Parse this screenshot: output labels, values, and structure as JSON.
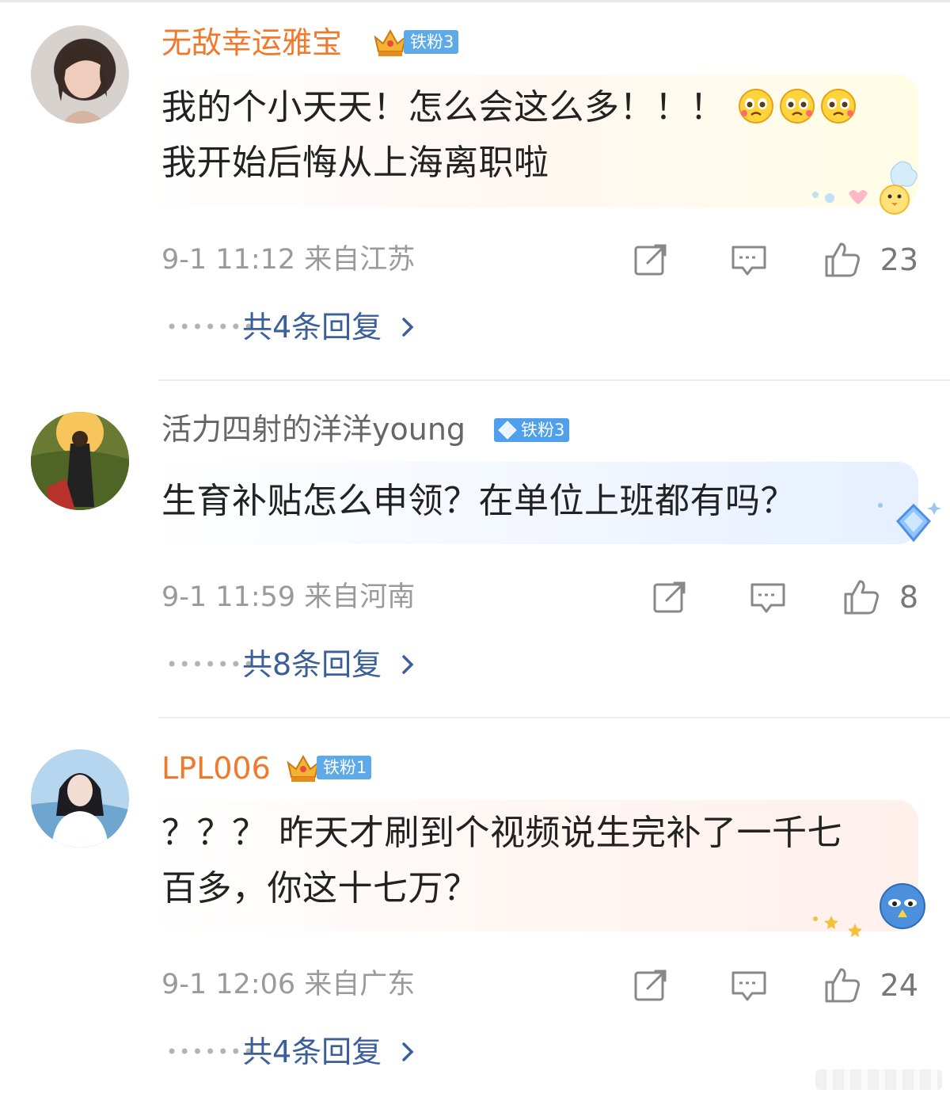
{
  "comments": [
    {
      "username": "无敌幸运雅宝",
      "badge": "铁粉3",
      "text_line1": "我的个小天天！怎么会这么多！！！",
      "text_line2": "我开始后悔从上海离职啦",
      "timestamp": "9-1 11:12 来自江苏",
      "likes": "23",
      "replies": "共4条回复"
    },
    {
      "username": "活力四射的洋洋young",
      "badge": "铁粉3",
      "text_line1": "生育补贴怎么申领？在单位上班都有吗？",
      "timestamp": "9-1 11:59 来自河南",
      "likes": "8",
      "replies": "共8条回复"
    },
    {
      "username": "LPL006",
      "badge": "铁粉1",
      "text_line1": "？？？ 昨天才刷到个视频说生完补了一千七",
      "text_line2": "百多，你这十七万？",
      "timestamp": "9-1 12:06 来自广东",
      "likes": "24",
      "replies": "共4条回复"
    }
  ],
  "icons": {
    "share": "share-icon",
    "reply": "comment-icon",
    "like": "thumbs-up-icon",
    "chevron": "chevron-right-icon",
    "emoji": "crying-emoji-icon"
  },
  "colors": {
    "username_orange": "#f0792b",
    "username_gray": "#666666",
    "badge_blue": "#5ea9e8",
    "reply_link": "#3b5f9a",
    "meta_gray": "#9a9a9a"
  }
}
